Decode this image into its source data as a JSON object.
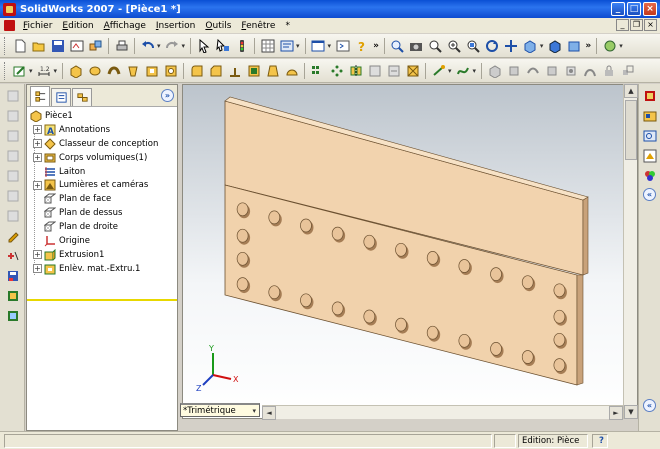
{
  "window": {
    "title": "SolidWorks 2007 - [Pièce1 *]",
    "min_glyph": "_",
    "max_glyph": "□",
    "close_glyph": "×"
  },
  "menu": [
    "Fichier",
    "Edition",
    "Affichage",
    "Insertion",
    "Outils",
    "Fenêtre",
    "*"
  ],
  "mdi": {
    "min_glyph": "_",
    "restore_glyph": "❐",
    "close_glyph": "×"
  },
  "toolbar_chevron": "»",
  "panel": {
    "collapse_glyph": "»",
    "tree": [
      {
        "label": "Pièce1",
        "icon": "part-icon",
        "expander": ""
      },
      {
        "label": "Annotations",
        "icon": "annotations-icon",
        "expander": "+"
      },
      {
        "label": "Classeur de conception",
        "icon": "design-binder-icon",
        "expander": "+"
      },
      {
        "label": "Corps volumiques(1)",
        "icon": "solid-bodies-icon",
        "expander": "+"
      },
      {
        "label": "Laiton",
        "icon": "material-icon",
        "expander": ""
      },
      {
        "label": "Lumières et caméras",
        "icon": "lights-cameras-icon",
        "expander": "+"
      },
      {
        "label": "Plan de face",
        "icon": "plane-icon",
        "expander": ""
      },
      {
        "label": "Plan de dessus",
        "icon": "plane-icon",
        "expander": ""
      },
      {
        "label": "Plan de droite",
        "icon": "plane-icon",
        "expander": ""
      },
      {
        "label": "Origine",
        "icon": "origin-icon",
        "expander": ""
      },
      {
        "label": "Extrusion1",
        "icon": "extrude-icon",
        "expander": "+"
      },
      {
        "label": "Enlèv. mat.-Extru.1",
        "icon": "cut-extrude-icon",
        "expander": "+"
      }
    ]
  },
  "viewport": {
    "view_tab": "*Trimétrique",
    "view_tab_dd": "▾",
    "axis_x": "X",
    "axis_y": "Y",
    "axis_z": "Z"
  },
  "scroll": {
    "up": "▲",
    "down": "▼",
    "left": "◄",
    "right": "►"
  },
  "right_collapse_glyph": "«",
  "status": {
    "mode": "Edition: Pièce",
    "help": "?"
  },
  "colors": {
    "title_bar": "#0a4fd4",
    "plate_face": "#f1d2ac",
    "plate_edge": "#c9a27a",
    "rollback_bar": "#e8d800"
  }
}
